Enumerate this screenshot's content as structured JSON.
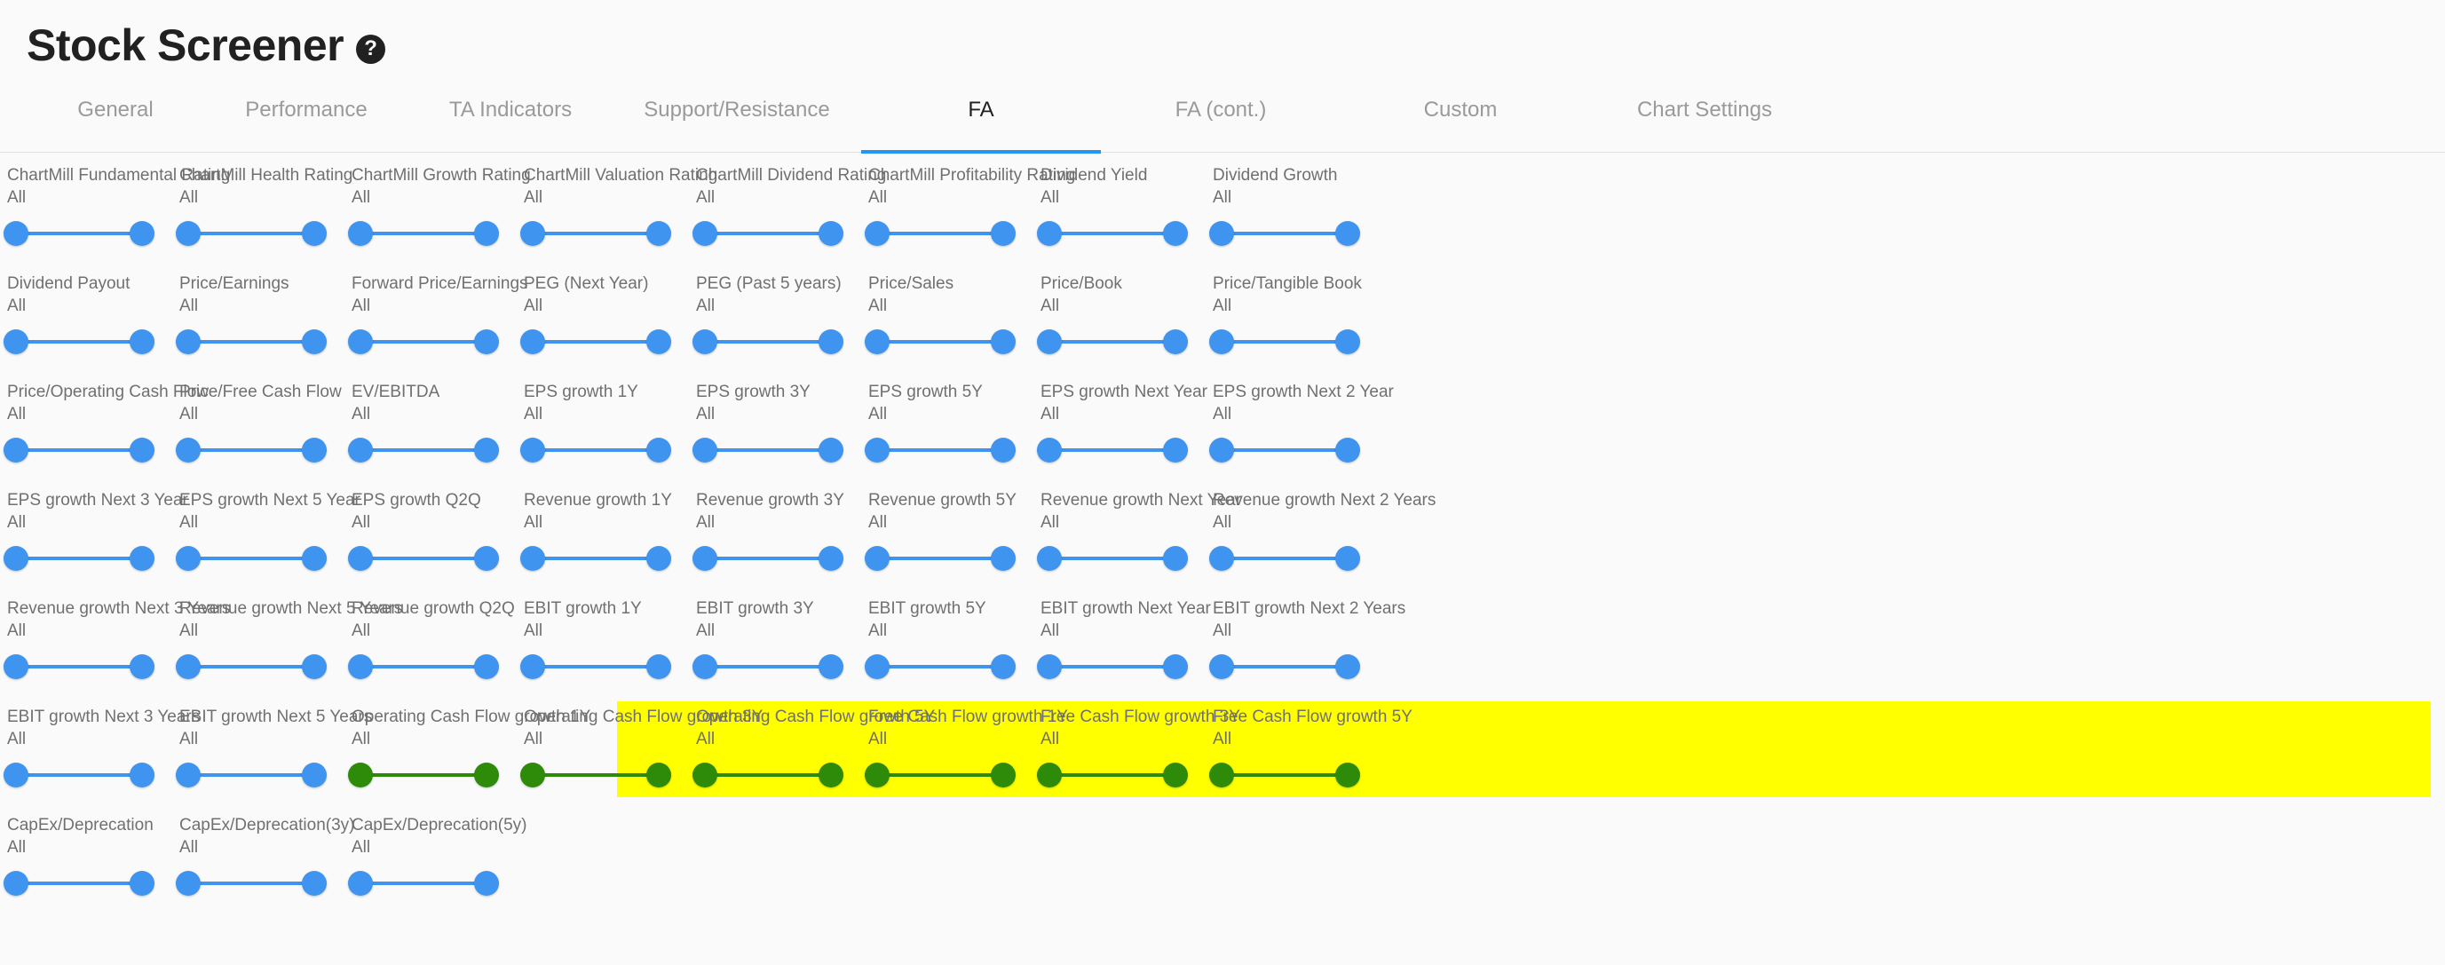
{
  "header": {
    "title": "Stock Screener",
    "help_icon": "help-circle-icon",
    "help_label": "?"
  },
  "tabs": [
    {
      "label": "General",
      "active": false
    },
    {
      "label": "Performance",
      "active": false
    },
    {
      "label": "TA Indicators",
      "active": false
    },
    {
      "label": "Support/Resistance",
      "active": false
    },
    {
      "label": "FA",
      "active": true
    },
    {
      "label": "FA (cont.)",
      "active": false
    },
    {
      "label": "Custom",
      "active": false
    },
    {
      "label": "Chart Settings",
      "active": false
    }
  ],
  "colors": {
    "accent": "#2196f3",
    "slider_blue": "#3f94ef",
    "slider_green": "#2e8b09",
    "highlight_yellow": "#ffff00",
    "label_grey": "#707070",
    "page_bg": "#fafafa"
  },
  "common": {
    "all_value": "All"
  },
  "filter_rows": [
    {
      "highlighted": false,
      "filters": [
        {
          "label": "ChartMill Fundamental Rating",
          "value": "All",
          "slider": "blue"
        },
        {
          "label": "ChartMill Health Rating",
          "value": "All",
          "slider": "blue"
        },
        {
          "label": "ChartMill Growth Rating",
          "value": "All",
          "slider": "blue"
        },
        {
          "label": "ChartMill Valuation Rating",
          "value": "All",
          "slider": "blue"
        },
        {
          "label": "ChartMill Dividend Rating",
          "value": "All",
          "slider": "blue"
        },
        {
          "label": "ChartMill Profitability Rating",
          "value": "All",
          "slider": "blue"
        },
        {
          "label": "Dividend Yield",
          "value": "All",
          "slider": "blue"
        },
        {
          "label": "Dividend Growth",
          "value": "All",
          "slider": "blue"
        }
      ]
    },
    {
      "highlighted": false,
      "filters": [
        {
          "label": "Dividend Payout",
          "value": "All",
          "slider": "blue"
        },
        {
          "label": "Price/Earnings",
          "value": "All",
          "slider": "blue"
        },
        {
          "label": "Forward Price/Earnings",
          "value": "All",
          "slider": "blue"
        },
        {
          "label": "PEG (Next Year)",
          "value": "All",
          "slider": "blue"
        },
        {
          "label": "PEG (Past 5 years)",
          "value": "All",
          "slider": "blue"
        },
        {
          "label": "Price/Sales",
          "value": "All",
          "slider": "blue"
        },
        {
          "label": "Price/Book",
          "value": "All",
          "slider": "blue"
        },
        {
          "label": "Price/Tangible Book",
          "value": "All",
          "slider": "blue"
        }
      ]
    },
    {
      "highlighted": false,
      "filters": [
        {
          "label": "Price/Operating Cash Flow",
          "value": "All",
          "slider": "blue"
        },
        {
          "label": "Price/Free Cash Flow",
          "value": "All",
          "slider": "blue"
        },
        {
          "label": "EV/EBITDA",
          "value": "All",
          "slider": "blue"
        },
        {
          "label": "EPS growth 1Y",
          "value": "All",
          "slider": "blue"
        },
        {
          "label": "EPS growth 3Y",
          "value": "All",
          "slider": "blue"
        },
        {
          "label": "EPS growth 5Y",
          "value": "All",
          "slider": "blue"
        },
        {
          "label": "EPS growth Next Year",
          "value": "All",
          "slider": "blue"
        },
        {
          "label": "EPS growth Next 2 Year",
          "value": "All",
          "slider": "blue"
        }
      ]
    },
    {
      "highlighted": false,
      "filters": [
        {
          "label": "EPS growth Next 3 Year",
          "value": "All",
          "slider": "blue"
        },
        {
          "label": "EPS growth Next 5 Year",
          "value": "All",
          "slider": "blue"
        },
        {
          "label": "EPS growth Q2Q",
          "value": "All",
          "slider": "blue"
        },
        {
          "label": "Revenue growth 1Y",
          "value": "All",
          "slider": "blue"
        },
        {
          "label": "Revenue growth 3Y",
          "value": "All",
          "slider": "blue"
        },
        {
          "label": "Revenue growth 5Y",
          "value": "All",
          "slider": "blue"
        },
        {
          "label": "Revenue growth Next Year",
          "value": "All",
          "slider": "blue"
        },
        {
          "label": "Revenue growth Next 2 Years",
          "value": "All",
          "slider": "blue"
        }
      ]
    },
    {
      "highlighted": false,
      "filters": [
        {
          "label": "Revenue growth Next 3 Years",
          "value": "All",
          "slider": "blue"
        },
        {
          "label": "Revenue growth Next 5 Years",
          "value": "All",
          "slider": "blue"
        },
        {
          "label": "Revenue growth Q2Q",
          "value": "All",
          "slider": "blue"
        },
        {
          "label": "EBIT growth 1Y",
          "value": "All",
          "slider": "blue"
        },
        {
          "label": "EBIT growth 3Y",
          "value": "All",
          "slider": "blue"
        },
        {
          "label": "EBIT growth 5Y",
          "value": "All",
          "slider": "blue"
        },
        {
          "label": "EBIT growth Next Year",
          "value": "All",
          "slider": "blue"
        },
        {
          "label": "EBIT growth Next 2 Years",
          "value": "All",
          "slider": "blue"
        }
      ]
    },
    {
      "highlighted": true,
      "highlight_from_index": 2,
      "filters": [
        {
          "label": "EBIT growth Next 3 Years",
          "value": "All",
          "slider": "blue",
          "highlighted": false
        },
        {
          "label": "EBIT growth Next 5 Years",
          "value": "All",
          "slider": "blue",
          "highlighted": false
        },
        {
          "label": "Operating Cash Flow growth 1Y",
          "value": "All",
          "slider": "green",
          "highlighted": true
        },
        {
          "label": "Operating Cash Flow growth 3Y",
          "value": "All",
          "slider": "green",
          "highlighted": true
        },
        {
          "label": "Operating Cash Flow growth 5Y",
          "value": "All",
          "slider": "green",
          "highlighted": true
        },
        {
          "label": "Free Cash Flow growth 1Y",
          "value": "All",
          "slider": "green",
          "highlighted": true
        },
        {
          "label": "Free Cash Flow growth 3Y",
          "value": "All",
          "slider": "green",
          "highlighted": true
        },
        {
          "label": "Free Cash Flow growth 5Y",
          "value": "All",
          "slider": "green",
          "highlighted": true
        }
      ]
    },
    {
      "highlighted": false,
      "filters": [
        {
          "label": "CapEx/Deprecation",
          "value": "All",
          "slider": "blue"
        },
        {
          "label": "CapEx/Deprecation(3y)",
          "value": "All",
          "slider": "blue"
        },
        {
          "label": "CapEx/Deprecation(5y)",
          "value": "All",
          "slider": "blue"
        }
      ]
    }
  ]
}
